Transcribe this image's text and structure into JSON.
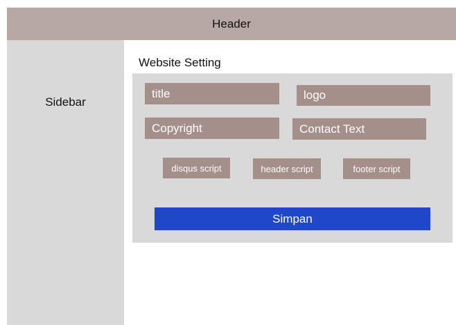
{
  "header": {
    "title": "Header"
  },
  "sidebar": {
    "label": "Sidebar"
  },
  "main": {
    "section_title": "Website Setting",
    "fields": {
      "title": "title",
      "logo": "logo",
      "copyright": "Copyright",
      "contact_text": "Contact Text",
      "disqus_script": "disqus script",
      "header_script": "header script",
      "footer_script": "footer script"
    },
    "save_label": "Simpan"
  },
  "colors": {
    "header_bg": "#b7a8a4",
    "sidebar_bg": "#d9d9d9",
    "field_bg": "#a48f8a",
    "button_bg": "#1f48c8"
  }
}
